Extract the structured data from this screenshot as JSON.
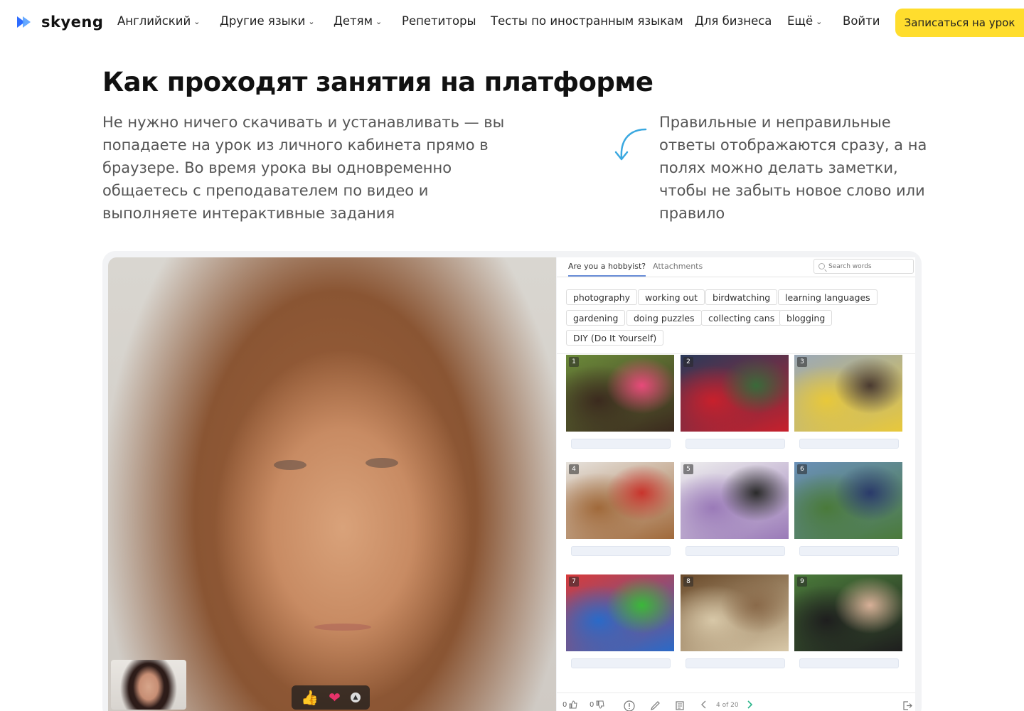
{
  "brand": {
    "name": "skyeng",
    "accent": "#ffdd2d",
    "logo_blue": "#2d6cff"
  },
  "nav": {
    "items": [
      {
        "label": "Английский",
        "has_dropdown": true
      },
      {
        "label": "Другие языки",
        "has_dropdown": true
      },
      {
        "label": "Детям",
        "has_dropdown": true
      },
      {
        "label": "Репетиторы",
        "has_dropdown": false
      },
      {
        "label": "Тесты по иностранным языкам",
        "has_dropdown": false
      },
      {
        "label": "Для бизнеса",
        "has_dropdown": false
      },
      {
        "label": "Ещё",
        "has_dropdown": true
      }
    ],
    "login": "Войти",
    "cta": "Записаться на урок"
  },
  "section": {
    "title": "Как проходят занятия на платформе",
    "lead": "Не нужно ничего скачивать и устанавливать — вы попадаете на урок из личного кабинета прямо в браузере. Во время урока вы одновременно общаетесь с преподавателем по видео и выполняете интерактивные задания",
    "side_note": "Правильные и неправильные ответы отображаются сразу, а на полях можно делать заметки, чтобы не забыть новое слово или правило"
  },
  "lesson": {
    "tabs": [
      {
        "label": "Are you a hobbyist?",
        "active": true
      },
      {
        "label": "Attachments",
        "active": false
      }
    ],
    "search_placeholder": "Search words",
    "chips": [
      "photography",
      "working out",
      "birdwatching",
      "learning languages",
      "gardening",
      "doing puzzles",
      "collecting cans",
      "blogging",
      "DIY (Do It Yourself)"
    ],
    "pictures": [
      {
        "num": "1",
        "icon": "gardening-photo",
        "c1": "#6b8a3a",
        "c2": "#3b2a1e",
        "c3": "#e84a7a"
      },
      {
        "num": "2",
        "icon": "headphones-flag-photo",
        "c1": "#2a3a5a",
        "c2": "#c8202c",
        "c3": "#3a6a3a"
      },
      {
        "num": "3",
        "icon": "blogger-photo",
        "c1": "#9aa8b8",
        "c2": "#e8c83a",
        "c3": "#4a3a30"
      },
      {
        "num": "4",
        "icon": "diy-photo",
        "c1": "#e6e2dc",
        "c2": "#a0693a",
        "c3": "#c8342c"
      },
      {
        "num": "5",
        "icon": "workout-photo",
        "c1": "#eeeeee",
        "c2": "#9a7ab8",
        "c3": "#2a2a2a"
      },
      {
        "num": "6",
        "icon": "birdwatching-photo",
        "c1": "#6a90b8",
        "c2": "#4a7a3a",
        "c3": "#2a3a6a"
      },
      {
        "num": "7",
        "icon": "cans-photo",
        "c1": "#d83a3a",
        "c2": "#2a6ac8",
        "c3": "#3ab83a"
      },
      {
        "num": "8",
        "icon": "puzzles-photo",
        "c1": "#6a4a2a",
        "c2": "#d8c8a8",
        "c3": "#8a6a4a"
      },
      {
        "num": "9",
        "icon": "photography-photo",
        "c1": "#4a7a3a",
        "c2": "#1e1e1e",
        "c3": "#d8b098"
      }
    ],
    "toolbar": {
      "likes": "0",
      "dislikes": "0",
      "pagination": "4 of 20"
    }
  },
  "reactions": [
    "thumbs-up-icon",
    "heart-icon"
  ]
}
